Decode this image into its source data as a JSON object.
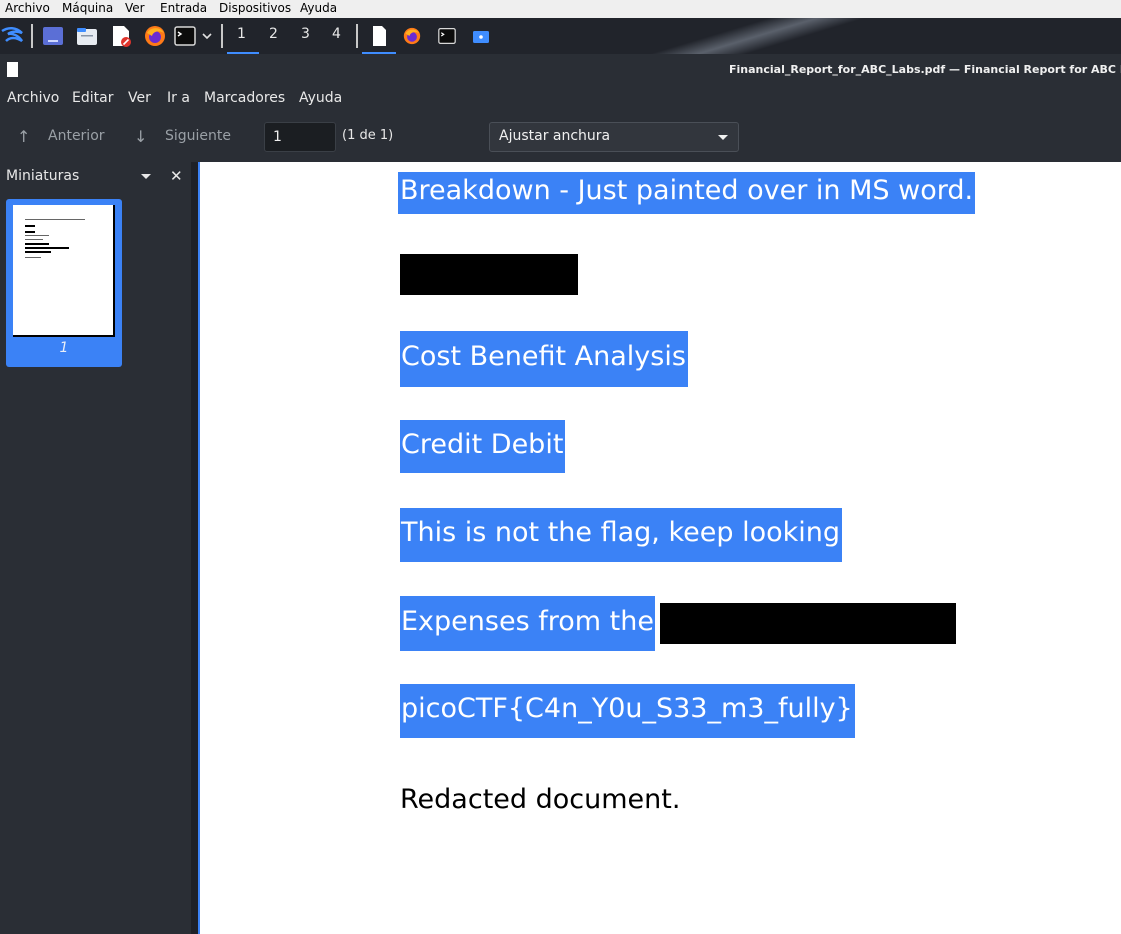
{
  "vbox_menu": {
    "items": [
      "Archivo",
      "Máquina",
      "Ver",
      "Entrada",
      "Dispositivos",
      "Ayuda"
    ]
  },
  "panel": {
    "workspaces": [
      "1",
      "2",
      "3",
      "4"
    ],
    "active_workspace": "1",
    "launchers": [
      "kali-menu-icon",
      "show-desktop-icon",
      "file-manager-icon",
      "text-editor-icon",
      "firefox-icon",
      "terminal-icon",
      "chevron-down-icon"
    ],
    "tasks": [
      "okular-window-icon",
      "firefox-window-icon",
      "terminal-window-icon",
      "folder-window-icon"
    ]
  },
  "window": {
    "title": "Financial_Report_for_ABC_Labs.pdf — Financial Report for ABC Labs.do"
  },
  "app_menu": {
    "items": [
      "Archivo",
      "Editar",
      "Ver",
      "Ir a",
      "Marcadores",
      "Ayuda"
    ]
  },
  "toolbar": {
    "previous_label": "Anterior",
    "next_label": "Siguiente",
    "page_value": "1",
    "page_count": "(1 de 1)",
    "zoom_value": "Ajustar anchura"
  },
  "sidebar": {
    "title": "Miniaturas",
    "thumbnail_page": "1"
  },
  "document": {
    "lines": [
      "Breakdown - Just painted over in MS word.",
      "Cost Benefit Analysis",
      "Credit Debit",
      "This is not the flag, keep looking",
      "Expenses from the ",
      "picoCTF{C4n_Y0u_S33_m3_fully}",
      "Redacted document."
    ]
  },
  "colors": {
    "selection": "#3b82f6",
    "panel_bg": "#21242b",
    "window_bg": "#2a2e35"
  }
}
